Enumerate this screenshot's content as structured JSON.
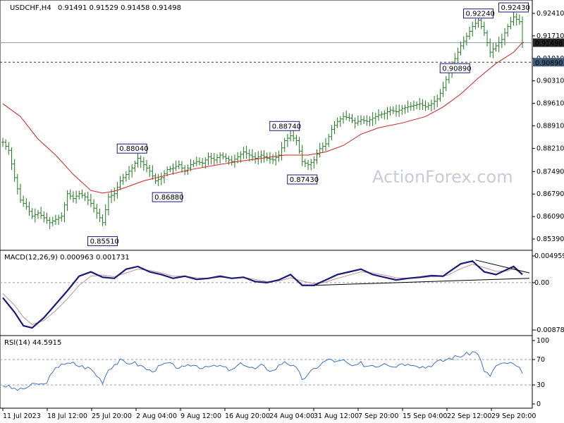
{
  "colors": {
    "bar": "#1e7a1e",
    "ema": "#d02020",
    "macd": "#1a1a7a",
    "signal": "#c89090",
    "rsi": "#3b73c8",
    "label_border": "#1a1a7a",
    "label_text": "#1a1a7a",
    "grid_dash": "#9aa0a8",
    "price_tag_bg": "#222222",
    "level_tag_bg": "#3c5a78",
    "watermark": "#c8ccd8"
  },
  "header": {
    "symbol": "USDCHF,H4",
    "ohlc": "0.91491 0.91529 0.91458 0.91498"
  },
  "watermark": "ActionForex.com",
  "current_price_tag": "0.91498",
  "level_tag": "0.90890",
  "chart_data": [
    {
      "type": "ohlc",
      "title": "USDCHF,H4",
      "ylim": [
        0.8515,
        0.9265
      ],
      "yticks": [
        "0.92410",
        "0.91710",
        "0.91010",
        "0.90310",
        "0.89610",
        "0.88910",
        "0.88210",
        "0.87490",
        "0.86790",
        "0.86090",
        "0.85390"
      ],
      "xticks": [
        "11 Jul 2023",
        "18 Jul 12:00",
        "25 Jul 20:00",
        "2 Aug 04:00",
        "9 Aug 12:00",
        "16 Aug 20:00",
        "24 Aug 04:00",
        "31 Aug 12:00",
        "7 Sep 20:00",
        "15 Sep 04:00",
        "22 Sep 12:00",
        "29 Sep 20:00"
      ],
      "close_path": [
        [
          0,
          0.884
        ],
        [
          2,
          0.8815
        ],
        [
          4,
          0.873
        ],
        [
          6,
          0.866
        ],
        [
          8,
          0.864
        ],
        [
          10,
          0.861
        ],
        [
          12,
          0.862
        ],
        [
          14,
          0.8605
        ],
        [
          16,
          0.859
        ],
        [
          18,
          0.86
        ],
        [
          20,
          0.861
        ],
        [
          22,
          0.868
        ],
        [
          24,
          0.8665
        ],
        [
          26,
          0.868
        ],
        [
          28,
          0.867
        ],
        [
          30,
          0.865
        ],
        [
          32,
          0.862
        ],
        [
          34,
          0.859
        ],
        [
          36,
          0.867
        ],
        [
          38,
          0.868
        ],
        [
          40,
          0.872
        ],
        [
          42,
          0.874
        ],
        [
          44,
          0.876
        ],
        [
          46,
          0.879
        ],
        [
          48,
          0.877
        ],
        [
          50,
          0.875
        ],
        [
          52,
          0.872
        ],
        [
          54,
          0.873
        ],
        [
          56,
          0.8755
        ],
        [
          58,
          0.876
        ],
        [
          60,
          0.877
        ],
        [
          62,
          0.875
        ],
        [
          64,
          0.877
        ],
        [
          66,
          0.878
        ],
        [
          68,
          0.8775
        ],
        [
          70,
          0.8795
        ],
        [
          72,
          0.8785
        ],
        [
          74,
          0.88
        ],
        [
          76,
          0.879
        ],
        [
          78,
          0.878
        ],
        [
          80,
          0.8795
        ],
        [
          82,
          0.881
        ],
        [
          84,
          0.88
        ],
        [
          86,
          0.879
        ],
        [
          88,
          0.88
        ],
        [
          90,
          0.879
        ],
        [
          92,
          0.8785
        ],
        [
          94,
          0.88
        ],
        [
          96,
          0.8845
        ],
        [
          98,
          0.886
        ],
        [
          100,
          0.8845
        ],
        [
          102,
          0.878
        ],
        [
          104,
          0.877
        ],
        [
          106,
          0.8785
        ],
        [
          108,
          0.882
        ],
        [
          110,
          0.8835
        ],
        [
          112,
          0.888
        ],
        [
          114,
          0.8905
        ],
        [
          116,
          0.892
        ],
        [
          118,
          0.8915
        ],
        [
          120,
          0.89
        ],
        [
          122,
          0.891
        ],
        [
          124,
          0.8905
        ],
        [
          126,
          0.8915
        ],
        [
          128,
          0.8925
        ],
        [
          130,
          0.893
        ],
        [
          132,
          0.894
        ],
        [
          134,
          0.8935
        ],
        [
          136,
          0.8945
        ],
        [
          138,
          0.895
        ],
        [
          140,
          0.8955
        ],
        [
          142,
          0.896
        ],
        [
          144,
          0.895
        ],
        [
          146,
          0.896
        ],
        [
          148,
          0.8975
        ],
        [
          150,
          0.901
        ],
        [
          152,
          0.906
        ],
        [
          154,
          0.91
        ],
        [
          156,
          0.914
        ],
        [
          158,
          0.917
        ],
        [
          160,
          0.92
        ],
        [
          162,
          0.922
        ],
        [
          164,
          0.918
        ],
        [
          166,
          0.912
        ],
        [
          168,
          0.914
        ],
        [
          170,
          0.916
        ],
        [
          172,
          0.92
        ],
        [
          174,
          0.923
        ],
        [
          176,
          0.9215
        ],
        [
          177,
          0.915
        ]
      ],
      "ema_path": [
        [
          0,
          0.896
        ],
        [
          6,
          0.892
        ],
        [
          12,
          0.885
        ],
        [
          18,
          0.88
        ],
        [
          24,
          0.874
        ],
        [
          30,
          0.869
        ],
        [
          34,
          0.8682
        ],
        [
          38,
          0.8688
        ],
        [
          42,
          0.87
        ],
        [
          48,
          0.872
        ],
        [
          56,
          0.8738
        ],
        [
          64,
          0.8755
        ],
        [
          72,
          0.8768
        ],
        [
          80,
          0.878
        ],
        [
          88,
          0.879
        ],
        [
          96,
          0.88
        ],
        [
          104,
          0.88
        ],
        [
          110,
          0.881
        ],
        [
          116,
          0.883
        ],
        [
          122,
          0.8865
        ],
        [
          128,
          0.8885
        ],
        [
          136,
          0.89
        ],
        [
          144,
          0.892
        ],
        [
          150,
          0.895
        ],
        [
          156,
          0.899
        ],
        [
          162,
          0.904
        ],
        [
          168,
          0.9085
        ],
        [
          174,
          0.912
        ],
        [
          177,
          0.915
        ]
      ],
      "labels": [
        {
          "text": "0.92430",
          "i": 174,
          "price": 0.9243
        },
        {
          "text": "0.92240",
          "i": 162,
          "price": 0.9224
        },
        {
          "text": "0.90890",
          "i": 154,
          "price": 0.9089
        },
        {
          "text": "0.88740",
          "i": 96,
          "price": 0.8874
        },
        {
          "text": "0.87430",
          "i": 102,
          "price": 0.8743
        },
        {
          "text": "0.88040",
          "i": 44,
          "price": 0.8804
        },
        {
          "text": "0.86880",
          "i": 56,
          "price": 0.8688
        },
        {
          "text": "0.85510",
          "i": 34,
          "price": 0.8551
        }
      ],
      "levels": [
        {
          "price": 0.91498,
          "style": "solid"
        },
        {
          "price": 0.9089,
          "style": "dashed"
        }
      ]
    },
    {
      "type": "line",
      "title": "MACD(12,26,9) 0.000963 0.001731",
      "ylim": [
        -0.00878,
        0.00496
      ],
      "yticks": [
        "0.004959",
        "0.00",
        "-0.008785"
      ],
      "macd": [
        [
          0,
          -0.0028
        ],
        [
          4,
          -0.0055
        ],
        [
          7,
          -0.008
        ],
        [
          10,
          -0.0084
        ],
        [
          14,
          -0.0065
        ],
        [
          18,
          -0.004
        ],
        [
          22,
          -0.0015
        ],
        [
          26,
          0.0012
        ],
        [
          30,
          0.002
        ],
        [
          34,
          0.001
        ],
        [
          38,
          0.0008
        ],
        [
          42,
          0.0025
        ],
        [
          46,
          0.003
        ],
        [
          50,
          0.002
        ],
        [
          54,
          0.0015
        ],
        [
          58,
          0.0008
        ],
        [
          62,
          0.0012
        ],
        [
          66,
          0.0006
        ],
        [
          70,
          0.0008
        ],
        [
          74,
          0.0012
        ],
        [
          78,
          0.0008
        ],
        [
          82,
          0.001
        ],
        [
          86,
          0.0002
        ],
        [
          90,
          0.0
        ],
        [
          94,
          0.0005
        ],
        [
          98,
          0.0015
        ],
        [
          102,
          -0.0005
        ],
        [
          106,
          -0.0005
        ],
        [
          110,
          0.0005
        ],
        [
          114,
          0.0015
        ],
        [
          118,
          0.002
        ],
        [
          122,
          0.0025
        ],
        [
          126,
          0.0015
        ],
        [
          130,
          0.001
        ],
        [
          134,
          0.0005
        ],
        [
          138,
          0.0008
        ],
        [
          142,
          0.001
        ],
        [
          146,
          0.0013
        ],
        [
          150,
          0.0012
        ],
        [
          152,
          0.002
        ],
        [
          156,
          0.0035
        ],
        [
          160,
          0.004
        ],
        [
          164,
          0.002
        ],
        [
          168,
          0.0015
        ],
        [
          172,
          0.0025
        ],
        [
          174,
          0.003
        ],
        [
          177,
          0.0015
        ]
      ],
      "signal": [
        [
          0,
          -0.002
        ],
        [
          4,
          -0.0042
        ],
        [
          7,
          -0.0064
        ],
        [
          10,
          -0.0078
        ],
        [
          14,
          -0.007
        ],
        [
          18,
          -0.0052
        ],
        [
          22,
          -0.003
        ],
        [
          26,
          -0.0005
        ],
        [
          30,
          0.0012
        ],
        [
          34,
          0.0014
        ],
        [
          38,
          0.0011
        ],
        [
          42,
          0.0018
        ],
        [
          46,
          0.0025
        ],
        [
          50,
          0.0023
        ],
        [
          54,
          0.0018
        ],
        [
          58,
          0.0012
        ],
        [
          62,
          0.0012
        ],
        [
          66,
          0.0009
        ],
        [
          70,
          0.0008
        ],
        [
          74,
          0.001
        ],
        [
          78,
          0.0009
        ],
        [
          82,
          0.001
        ],
        [
          86,
          0.0006
        ],
        [
          90,
          0.0002
        ],
        [
          94,
          0.0003
        ],
        [
          98,
          0.0009
        ],
        [
          102,
          0.0003
        ],
        [
          106,
          -0.0002
        ],
        [
          110,
          0.0001
        ],
        [
          114,
          0.0008
        ],
        [
          118,
          0.0014
        ],
        [
          122,
          0.002
        ],
        [
          126,
          0.0018
        ],
        [
          130,
          0.0014
        ],
        [
          134,
          0.0009
        ],
        [
          138,
          0.0008
        ],
        [
          142,
          0.0009
        ],
        [
          146,
          0.0011
        ],
        [
          150,
          0.0012
        ],
        [
          152,
          0.0015
        ],
        [
          156,
          0.0026
        ],
        [
          160,
          0.0034
        ],
        [
          164,
          0.0028
        ],
        [
          168,
          0.0021
        ],
        [
          172,
          0.0022
        ],
        [
          174,
          0.0026
        ],
        [
          177,
          0.0017
        ]
      ],
      "trendlines": [
        {
          "from": [
            106,
            -0.0005
          ],
          "to": [
            177,
            0.0008
          ]
        },
        {
          "from": [
            161,
            0.0042
          ],
          "to": [
            177,
            0.0018
          ]
        }
      ]
    },
    {
      "type": "line",
      "title": "RSI(14) 44.5915",
      "ylim": [
        0,
        100
      ],
      "yticks": [
        "100",
        "70",
        "30",
        "0"
      ],
      "levels": [
        70,
        30
      ],
      "rsi": [
        [
          0,
          30
        ],
        [
          3,
          25
        ],
        [
          6,
          22
        ],
        [
          9,
          28
        ],
        [
          12,
          32
        ],
        [
          14,
          30
        ],
        [
          16,
          42
        ],
        [
          18,
          55
        ],
        [
          20,
          65
        ],
        [
          22,
          62
        ],
        [
          24,
          64
        ],
        [
          26,
          60
        ],
        [
          28,
          58
        ],
        [
          30,
          55
        ],
        [
          32,
          45
        ],
        [
          34,
          35
        ],
        [
          36,
          55
        ],
        [
          38,
          62
        ],
        [
          40,
          68
        ],
        [
          42,
          64
        ],
        [
          44,
          66
        ],
        [
          46,
          62
        ],
        [
          48,
          58
        ],
        [
          50,
          52
        ],
        [
          52,
          55
        ],
        [
          54,
          60
        ],
        [
          56,
          64
        ],
        [
          58,
          60
        ],
        [
          60,
          58
        ],
        [
          62,
          56
        ],
        [
          64,
          62
        ],
        [
          66,
          60
        ],
        [
          68,
          58
        ],
        [
          70,
          62
        ],
        [
          72,
          58
        ],
        [
          74,
          60
        ],
        [
          76,
          56
        ],
        [
          78,
          52
        ],
        [
          80,
          60
        ],
        [
          82,
          64
        ],
        [
          84,
          58
        ],
        [
          86,
          55
        ],
        [
          88,
          60
        ],
        [
          90,
          56
        ],
        [
          92,
          52
        ],
        [
          94,
          60
        ],
        [
          96,
          68
        ],
        [
          98,
          62
        ],
        [
          100,
          55
        ],
        [
          102,
          40
        ],
        [
          104,
          45
        ],
        [
          106,
          55
        ],
        [
          108,
          62
        ],
        [
          110,
          68
        ],
        [
          112,
          70
        ],
        [
          114,
          66
        ],
        [
          116,
          68
        ],
        [
          118,
          62
        ],
        [
          120,
          58
        ],
        [
          122,
          64
        ],
        [
          124,
          60
        ],
        [
          126,
          62
        ],
        [
          128,
          60
        ],
        [
          130,
          66
        ],
        [
          132,
          62
        ],
        [
          134,
          60
        ],
        [
          136,
          65
        ],
        [
          138,
          62
        ],
        [
          140,
          64
        ],
        [
          142,
          60
        ],
        [
          144,
          58
        ],
        [
          146,
          62
        ],
        [
          148,
          66
        ],
        [
          150,
          68
        ],
        [
          152,
          72
        ],
        [
          154,
          74
        ],
        [
          156,
          76
        ],
        [
          158,
          78
        ],
        [
          160,
          82
        ],
        [
          162,
          80
        ],
        [
          164,
          50
        ],
        [
          166,
          45
        ],
        [
          168,
          60
        ],
        [
          170,
          62
        ],
        [
          172,
          65
        ],
        [
          174,
          62
        ],
        [
          176,
          55
        ],
        [
          177,
          45
        ]
      ]
    }
  ]
}
